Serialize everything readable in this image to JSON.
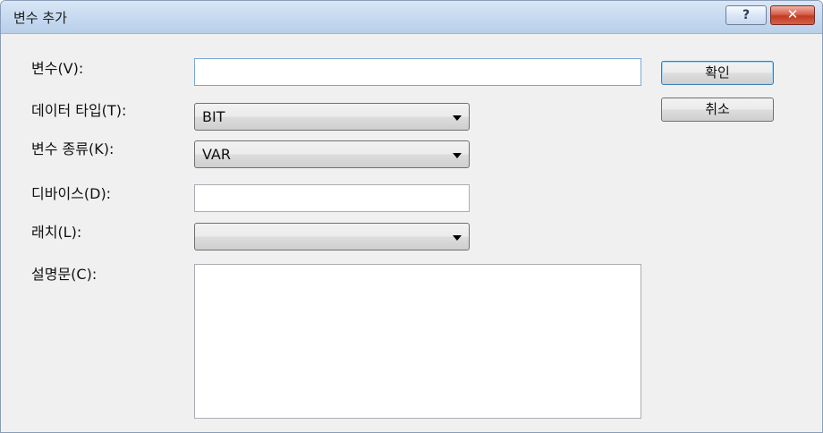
{
  "window": {
    "title": "변수 추가",
    "help_icon": "?",
    "close_icon": "✕"
  },
  "form": {
    "variable_label": "변수(V):",
    "variable_value": "",
    "data_type_label": "데이터 타입(T):",
    "data_type_value": "BIT",
    "variable_kind_label": "변수 종류(K):",
    "variable_kind_value": "VAR",
    "device_label": "디바이스(D):",
    "device_value": "",
    "latch_label": "래치(L):",
    "latch_value": "",
    "description_label": "설명문(C):",
    "description_value": ""
  },
  "buttons": {
    "ok": "확인",
    "cancel": "취소"
  }
}
